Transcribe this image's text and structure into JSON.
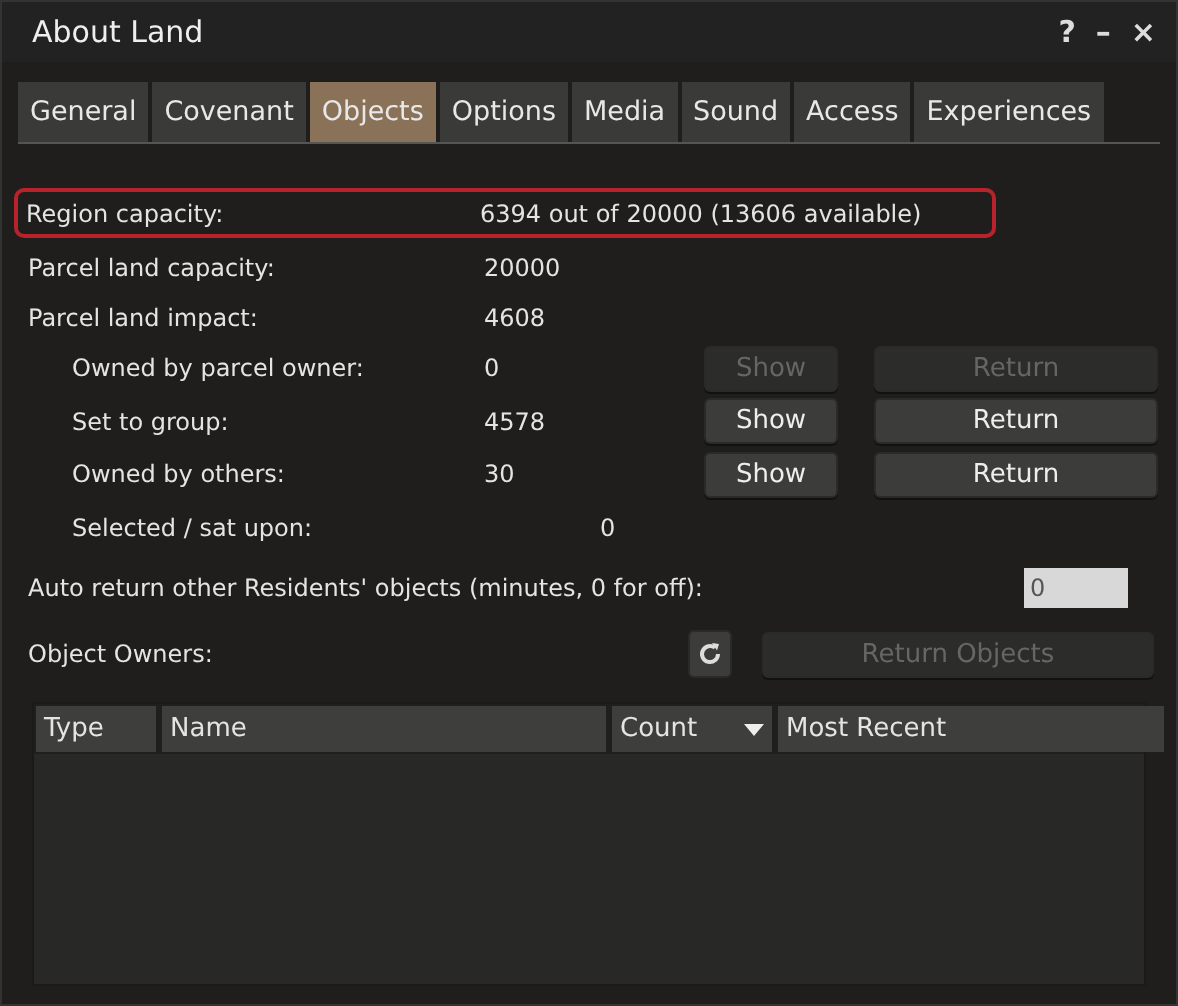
{
  "window": {
    "title": "About Land",
    "controls": [
      "?",
      "–",
      "×"
    ]
  },
  "tabs": [
    {
      "label": "General",
      "selected": false
    },
    {
      "label": "Covenant",
      "selected": false
    },
    {
      "label": "Objects",
      "selected": true
    },
    {
      "label": "Options",
      "selected": false
    },
    {
      "label": "Media",
      "selected": false
    },
    {
      "label": "Sound",
      "selected": false
    },
    {
      "label": "Access",
      "selected": false
    },
    {
      "label": "Experiences",
      "selected": false
    }
  ],
  "capacity": [
    {
      "label": "Region capacity:",
      "value": "6394 out of 20000 (13606 available)",
      "highlighted": true
    },
    {
      "label": "Parcel land capacity:",
      "value": "20000",
      "highlighted": false
    },
    {
      "label": "Parcel land impact:",
      "value": "4608",
      "highlighted": false,
      "children": [
        {
          "kind": "category",
          "label": "Owned by parcel owner:",
          "value": "0",
          "show": {
            "label": "Show",
            "disabled": true
          },
          "return": {
            "label": "Return",
            "disabled": true
          }
        },
        {
          "kind": "category",
          "label": "Set to group:",
          "value": "4578",
          "show": {
            "label": "Show",
            "disabled": false
          },
          "return": {
            "label": "Return",
            "disabled": false
          }
        },
        {
          "kind": "category",
          "label": "Owned by others:",
          "value": "30",
          "show": {
            "label": "Show",
            "disabled": false
          },
          "return": {
            "label": "Return",
            "disabled": false
          }
        },
        {
          "kind": "tally",
          "label": "Selected / sat upon:",
          "value": "0"
        }
      ]
    }
  ],
  "auto_return": {
    "label": "Auto return other Residents' objects (minutes, 0 for off):",
    "value": "0"
  },
  "object_owners": {
    "label": "Object Owners:",
    "return_button": {
      "label": "Return Objects",
      "disabled": true
    }
  },
  "table": {
    "columns": [
      {
        "label": "Type",
        "sorted": false
      },
      {
        "label": "Name",
        "sorted": false
      },
      {
        "label": "Count",
        "sorted": true
      },
      {
        "label": "Most Recent",
        "sorted": false
      }
    ]
  }
}
